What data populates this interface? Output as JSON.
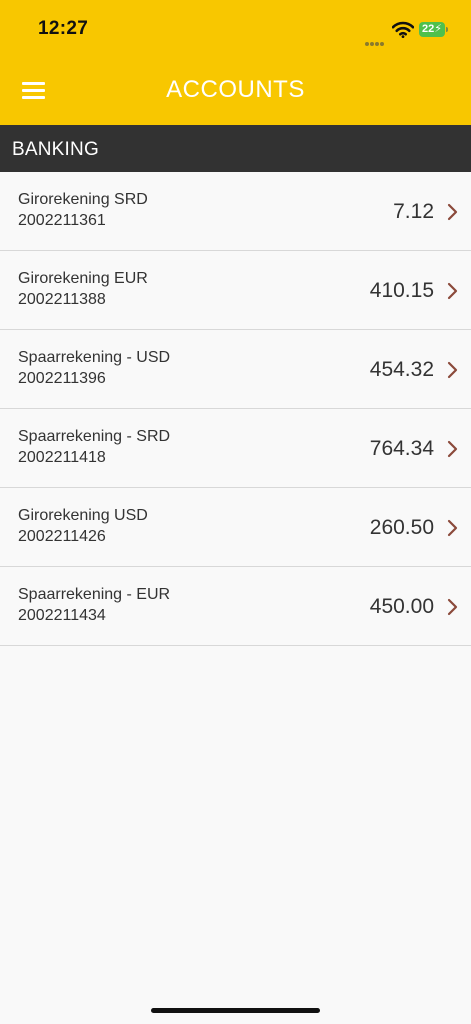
{
  "status_bar": {
    "time": "12:27",
    "battery": "22"
  },
  "header": {
    "title": "ACCOUNTS"
  },
  "section": {
    "label": "BANKING"
  },
  "accounts": [
    {
      "name": "Girorekening SRD",
      "number": "2002211361",
      "balance": "7.12"
    },
    {
      "name": "Girorekening EUR",
      "number": "2002211388",
      "balance": "410.15"
    },
    {
      "name": "Spaarrekening - USD",
      "number": "2002211396",
      "balance": "454.32"
    },
    {
      "name": "Spaarrekening - SRD",
      "number": "2002211418",
      "balance": "764.34"
    },
    {
      "name": "Girorekening USD",
      "number": "2002211426",
      "balance": "260.50"
    },
    {
      "name": "Spaarrekening - EUR",
      "number": "2002211434",
      "balance": "450.00"
    }
  ],
  "colors": {
    "header_background": "#f8c700",
    "section_background": "#323232",
    "chevron": "#8b4a3b",
    "battery": "#4fc04c"
  },
  "icons": {
    "menu": "hamburger-menu-icon",
    "row_disclosure": "chevron-right-icon",
    "wifi": "wifi-icon"
  }
}
